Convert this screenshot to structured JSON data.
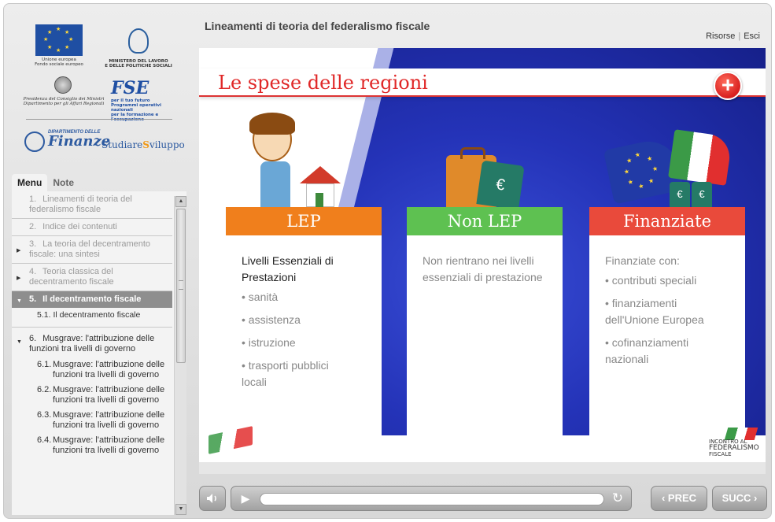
{
  "header": {
    "course_title": "Lineamenti di teoria del federalismo fiscale",
    "link_resources": "Risorse",
    "link_separator": "|",
    "link_exit": "Esci"
  },
  "logos": {
    "eu_caption": "Unione europea\nFondo sociale europeo",
    "ministry_caption": "MINISTERO DEL LAVORO\nE DELLE POLITICHE SOCIALI",
    "presidency_caption": "Presidenza del Consiglio dei Ministri\nDipartimento per gli Affari Regionali",
    "fse_brand": "FSE",
    "fse_caption": "per il tuo futuro\nProgrammi operativi nazionali\nper la formazione e l'occupazione",
    "finanze_small": "DIPARTIMENTO DELLE",
    "finanze_big": "Finanze",
    "studiare_a": "Studiare",
    "studiare_b": "S",
    "studiare_c": "viluppo"
  },
  "sidebar": {
    "tabs": [
      {
        "label": "Menu",
        "active": true
      },
      {
        "label": "Note",
        "active": false
      }
    ],
    "menu": [
      {
        "num": "1.",
        "label": "Lineamenti di teoria del federalismo fiscale",
        "arrow": ""
      },
      {
        "num": "2.",
        "label": "Indice dei contenuti",
        "arrow": ""
      },
      {
        "num": "3.",
        "label": "La teoria del decentramento fiscale: una sintesi",
        "arrow": "▶"
      },
      {
        "num": "4.",
        "label": "Teoria classica del decentramento fiscale",
        "arrow": "▶"
      },
      {
        "num": "5.",
        "label": "Il decentramento fiscale",
        "arrow": "▼"
      },
      {
        "num": "5.1.",
        "label": "Il decentramento fiscale"
      },
      {
        "num": "6.",
        "label": "Musgrave: l'attribuzione delle funzioni tra livelli di governo",
        "arrow": "▼"
      },
      {
        "num": "6.1.",
        "label": "Musgrave: l'attribuzione delle funzioni tra livelli di governo"
      },
      {
        "num": "6.2.",
        "label": "Musgrave: l'attribuzione delle funzioni tra livelli di governo"
      },
      {
        "num": "6.3.",
        "label": "Musgrave: l'attribuzione delle funzioni tra livelli di governo"
      },
      {
        "num": "6.4.",
        "label": "Musgrave: l'attribuzione delle funzioni tra livelli di governo"
      }
    ]
  },
  "slide": {
    "title": "Le spese delle regioni",
    "plus_label": "+",
    "columns": [
      {
        "heading": "LEP",
        "lead": "Livelli Essenziali di Prestazioni",
        "bullets": [
          "• sanità",
          "• assistenza",
          "• istruzione",
          "• trasporti pubblici\n  locali"
        ]
      },
      {
        "heading": "Non LEP",
        "lead": "Non rientrano nei livelli essenziali di prestazione",
        "bullets": []
      },
      {
        "heading": "Finanziate",
        "lead": "Finanziate con:",
        "bullets": [
          "• contributi speciali",
          "• finanziamenti\n  dell'Unione Europea",
          "• cofinanziamenti\n  nazionali"
        ]
      }
    ],
    "euro_symbol": "€",
    "corner_logo_line1": "INCONTRO AL",
    "corner_logo_line2": "FEDERALISMO",
    "corner_logo_line3": "FISCALE"
  },
  "controls": {
    "prev_label": "‹ PREC",
    "next_label": "SUCC ›",
    "progress": 0.0
  },
  "icons": {
    "mute": "speaker-icon",
    "play": "play-icon",
    "replay": "replay-icon",
    "scroll_up": "triangle-up-icon",
    "scroll_down": "triangle-down-icon"
  },
  "colors": {
    "lep": "#f07f1c",
    "non_lep": "#5ec151",
    "finanziate": "#e94a3b",
    "title_red": "#e02828",
    "slide_blue": "#2433b8"
  }
}
